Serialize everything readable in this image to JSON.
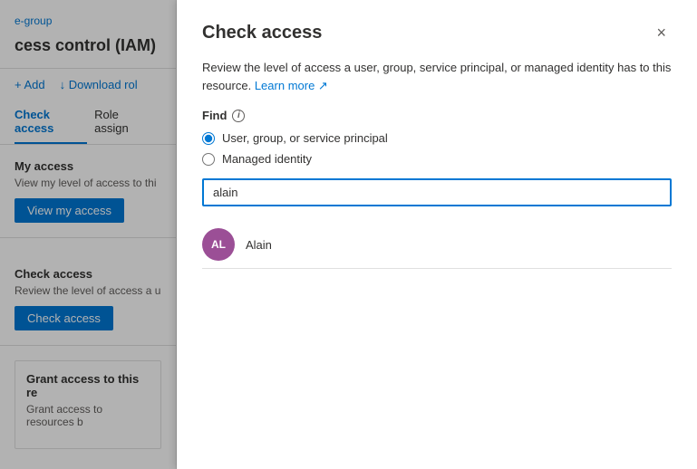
{
  "breadcrumb": {
    "text": "e-group"
  },
  "left": {
    "page_title": "cess control (IAM)",
    "toolbar": {
      "add_label": "+ Add",
      "download_label": "↓ Download rol"
    },
    "tabs": [
      {
        "label": "Check access",
        "active": true
      },
      {
        "label": "Role assign",
        "active": false
      }
    ],
    "my_access": {
      "title": "My access",
      "desc": "View my level of access to thi",
      "btn_label": "View my access"
    },
    "check_access": {
      "title": "Check access",
      "desc": "Review the level of access a u",
      "btn_label": "Check access"
    },
    "grant": {
      "title": "Grant access to this re",
      "desc": "Grant access to resources b"
    }
  },
  "modal": {
    "title": "Check access",
    "close_label": "×",
    "description": "Review the level of access a user, group, service principal, or managed identity has to this resource.",
    "learn_more": "Learn more",
    "find_label": "Find",
    "radio_options": [
      {
        "label": "User, group, or service principal",
        "checked": true
      },
      {
        "label": "Managed identity",
        "checked": false
      }
    ],
    "search_value": "alain",
    "search_placeholder": "",
    "results": [
      {
        "initials": "AL",
        "name": "Alain"
      }
    ]
  }
}
